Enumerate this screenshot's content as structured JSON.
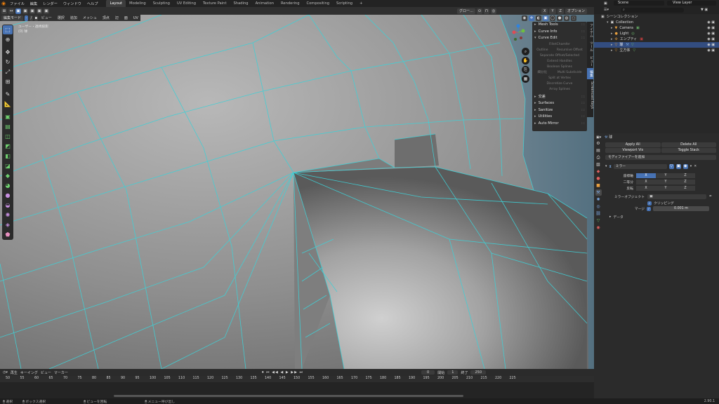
{
  "menu": [
    "ファイル",
    "編集",
    "レンダー",
    "ウィンドウ",
    "ヘルプ"
  ],
  "workspaces": [
    {
      "label": "Layout",
      "active": true
    },
    {
      "label": "Modeling",
      "active": false
    },
    {
      "label": "Sculpting",
      "active": false
    },
    {
      "label": "UV Editing",
      "active": false
    },
    {
      "label": "Texture Paint",
      "active": false
    },
    {
      "label": "Shading",
      "active": false
    },
    {
      "label": "Animation",
      "active": false
    },
    {
      "label": "Rendering",
      "active": false
    },
    {
      "label": "Compositing",
      "active": false
    },
    {
      "label": "Scripting",
      "active": false
    },
    {
      "label": "+",
      "active": false
    }
  ],
  "scene": {
    "name": "Scene",
    "view_layer": "View Layer"
  },
  "viewport": {
    "mode": "編集モード",
    "menus": [
      "ビュー",
      "選択",
      "追加",
      "メッシュ",
      "頂点",
      "辺",
      "面",
      "UV"
    ],
    "transform": "グロー…",
    "options": "オプション",
    "xyz": [
      "X",
      "Y",
      "Z"
    ],
    "info_line1": "ユーザー・透視投影",
    "info_line2": "(0) 球"
  },
  "npanel": {
    "sections": [
      {
        "label": "Mesh Tools",
        "expanded": false
      },
      {
        "label": "Curve Info",
        "expanded": false
      },
      {
        "label": "Curve Edit",
        "expanded": true
      }
    ],
    "curve_edit_items": [
      [
        "FilletChamfer"
      ],
      [
        "Outline",
        "Recursive Offset"
      ],
      [
        "Separate Offset/Selected"
      ],
      [
        "Extend Handles"
      ],
      [
        "Boolean Splines"
      ],
      [
        "細分化",
        "Multi Subdivide"
      ],
      [
        "Split at Vertex"
      ],
      [
        "Discretize Curve"
      ],
      [
        "Array Splines"
      ]
    ],
    "more_sections": [
      {
        "label": "交差"
      },
      {
        "label": "Surfaces"
      },
      {
        "label": "Sanitize"
      },
      {
        "label": "Utilities"
      },
      {
        "label": "Auto Mirror"
      }
    ],
    "tabs": [
      {
        "label": "アイテム",
        "active": false
      },
      {
        "label": "ツール",
        "active": false
      },
      {
        "label": "ビュー",
        "active": false
      },
      {
        "label": "編集",
        "active": true
      },
      {
        "label": "Screencast Keys",
        "active": false
      }
    ]
  },
  "timeline": {
    "menus": [
      "再生",
      "キーイング",
      "ビュー",
      "マーカー"
    ],
    "current_frame": "0",
    "start_label": "開始",
    "start": "1",
    "end_label": "終了",
    "end": "250",
    "ticks": [
      "50",
      "55",
      "60",
      "65",
      "70",
      "75",
      "80",
      "85",
      "90",
      "95",
      "100",
      "105",
      "110",
      "115",
      "120",
      "125",
      "130",
      "135",
      "140",
      "145",
      "150",
      "155",
      "160",
      "165",
      "170",
      "175",
      "180",
      "185",
      "190",
      "195",
      "200",
      "205",
      "210",
      "215",
      "220",
      "225"
    ]
  },
  "status": {
    "items": [
      "選択",
      "ボックス選択",
      "ビューを回転",
      "メニュー呼び出し"
    ],
    "version": "2.90.1"
  },
  "outliner": {
    "title": "シーンコレクション",
    "rows": [
      {
        "label": "Collection",
        "indent": 1,
        "selected": false
      },
      {
        "label": "Camera",
        "indent": 2,
        "selected": false
      },
      {
        "label": "Light",
        "indent": 2,
        "selected": false
      },
      {
        "label": "エンプティ",
        "indent": 2,
        "selected": false
      },
      {
        "label": "球",
        "indent": 2,
        "selected": true
      },
      {
        "label": "立方体",
        "indent": 2,
        "selected": false
      }
    ]
  },
  "properties": {
    "object_name": "球",
    "apply_all": "Apply All",
    "delete_all": "Delete All",
    "viewport_vis": "Viewport Vis",
    "toggle_stack": "Toggle Stack",
    "add_modifier": "モディファイアーを追加",
    "modifier_name": "ミラー",
    "axis_label": "座標軸",
    "bisect_label": "二等分",
    "flip_label": "反転",
    "axes": [
      "X",
      "Y",
      "Z"
    ],
    "mirror_object_label": "ミラーオブジェクト",
    "clipping_label": "クリッピング",
    "merge_label": "マージ",
    "merge_value": "0.001 m",
    "data_label": "データ"
  }
}
